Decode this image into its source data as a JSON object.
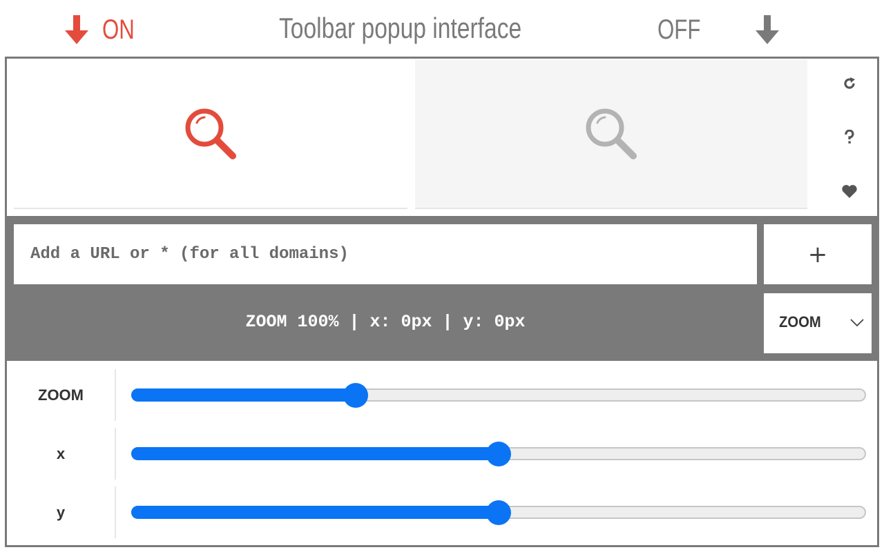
{
  "header": {
    "on_label": "ON",
    "title": "Toolbar popup interface",
    "off_label": "OFF",
    "on_color": "#e34c3c",
    "off_color": "#7a7a7a"
  },
  "toggles": {
    "on": {
      "icon": "magnifier-icon",
      "color": "#e34c3c"
    },
    "off": {
      "icon": "magnifier-icon",
      "color": "#b3b3b3"
    }
  },
  "side_icons": [
    {
      "name": "reset-icon",
      "glyph": "↻"
    },
    {
      "name": "help-icon",
      "glyph": "?"
    },
    {
      "name": "heart-icon",
      "glyph": "♥"
    }
  ],
  "url_bar": {
    "placeholder": "Add a URL or * (for all domains)",
    "value": "",
    "add_label": "+"
  },
  "status": {
    "text": "ZOOM 100% | x: 0px | y: 0px"
  },
  "mode_select": {
    "selected": "ZOOM"
  },
  "sliders": [
    {
      "label": "ZOOM",
      "fraction": 0.305
    },
    {
      "label": "x",
      "fraction": 0.5
    },
    {
      "label": "y",
      "fraction": 0.5
    }
  ],
  "colors": {
    "accent": "#0a74f5",
    "band": "#7a7a7a"
  }
}
